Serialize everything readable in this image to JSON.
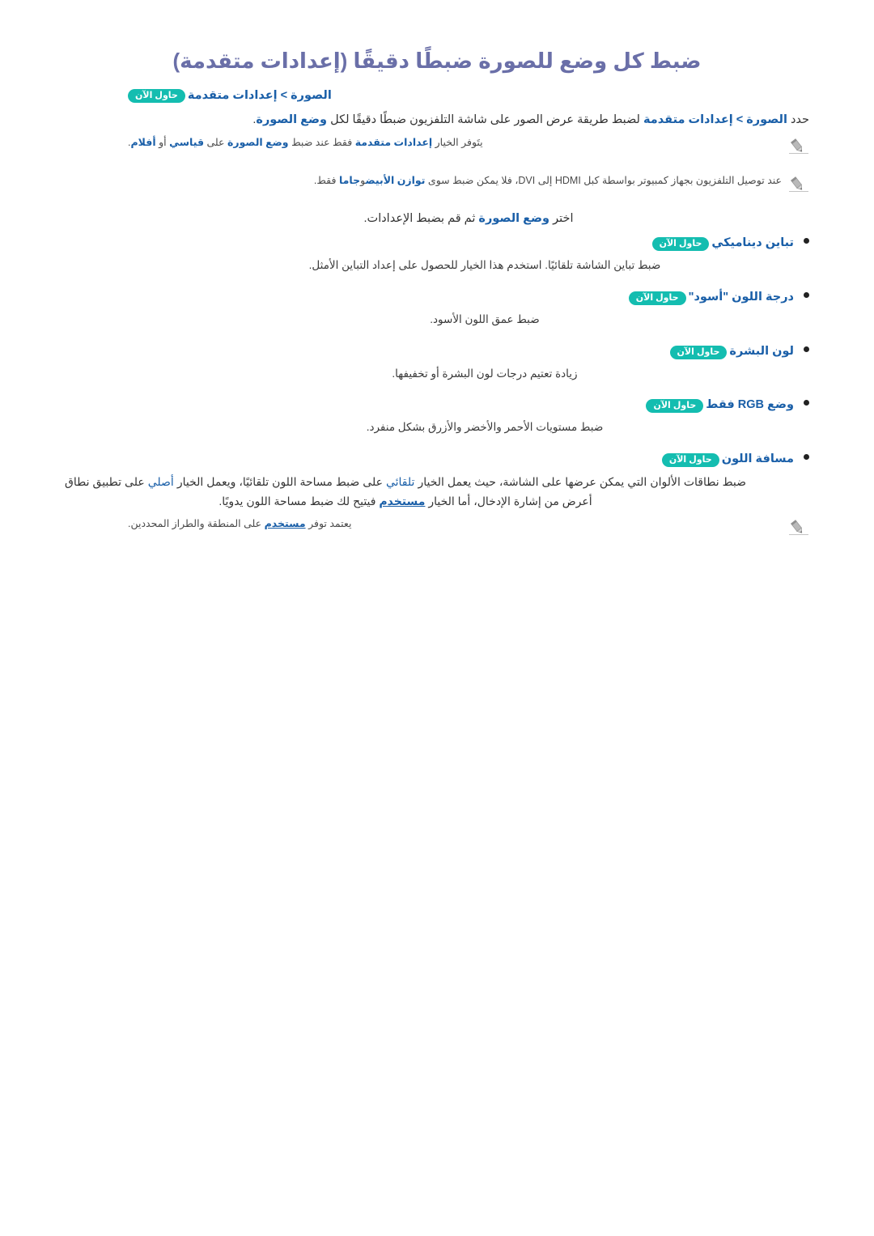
{
  "page": {
    "title": "ضبط كل وضع للصورة ضبطًا دقيقًا (إعدادات متقدمة)",
    "badge_label": "حاول الآن",
    "breadcrumb": "الصورة > إعدادات متقدمة",
    "intro_paragraph_lead": "حدد",
    "intro_breadcrumb_kw": "الصورة > إعدادات متقدمة",
    "intro_paragraph_mid": "لضبط طريقة عرض الصور على شاشة التلفزيون ضبطًا دقيقًا لكل",
    "intro_paragraph_kw2": "وضع الصورة",
    "intro_paragraph_end": ".",
    "note1": {
      "pre": "يتَوفر الخيار",
      "kw1": "إعدادات متقدمة",
      "mid1": "فقط عند ضبط",
      "kw2": "وضع الصورة",
      "mid2": "على",
      "kw3": "قياسي",
      "mid3": "أو",
      "kw4": "أفلام",
      "end": "."
    },
    "note2": {
      "pre": "عند توصيل التلفزيون بجهاز كمبيوتر بواسطة كبل HDMI إلى DVI، فلا يمكن ضبط سوى",
      "kw1": "توازن الأبيض",
      "mid1": "و",
      "kw2": "جاما",
      "end": "فقط."
    },
    "select_line_pre": "اختر",
    "select_line_kw": "وضع الصورة",
    "select_line_post": "ثم قم بضبط الإعدادات.",
    "bullets": [
      {
        "label": "تباين ديناميكي",
        "badge": "حاول الآن",
        "description": "ضبط تباين الشاشة تلقائيًا. استخدم هذا الخيار للحصول على إعداد التباين الأمثل."
      },
      {
        "label": "درجة اللون \"أسود\"",
        "badge": "حاول الآن",
        "description": "ضبط عمق اللون الأسود."
      },
      {
        "label": "لون البشرة",
        "badge": "حاول الآن",
        "description": "زيادة تعتيم درجات لون البشرة أو تخفيفها."
      },
      {
        "label": "وضع RGB فقط",
        "badge": "حاول الآن",
        "description": "ضبط مستويات الأحمر والأخضر والأزرق بشكل منفرد."
      },
      {
        "label": "مسافة اللون",
        "badge": "حاول الآن",
        "description": ""
      }
    ],
    "color_space": {
      "p1_pre": "ضبط نطاقات الألوان التي يمكن عرضها على الشاشة، حيث يعمل الخيار",
      "p1_kw": "تلقائي",
      "p1_mid": "على ضبط مساحة اللون تلقائيًا، ويعمل الخيار",
      "p2_kw": "أصلي",
      "p2_mid": "على تطبيق نطاق أعرض من إشارة الإدخال، أما الخيار",
      "p2_kw2": "مستخدم",
      "p2_end": "فيتيح لك ضبط مساحة اللون يدويًا."
    },
    "note3": {
      "pre": "يعتمد توفر",
      "kw": "مستخدم",
      "post": "على المنطقة والطراز المحددين."
    },
    "colors": {
      "title": "#6a6fa8",
      "link": "#1a5fa8",
      "badge_bg": "#14bdb0",
      "badge_text": "#ffffff",
      "body": "#333333",
      "note": "#4a4a4a",
      "background": "#ffffff"
    },
    "icons": {
      "note": "pencil-icon",
      "bullet": "bullet-dot-icon"
    }
  }
}
